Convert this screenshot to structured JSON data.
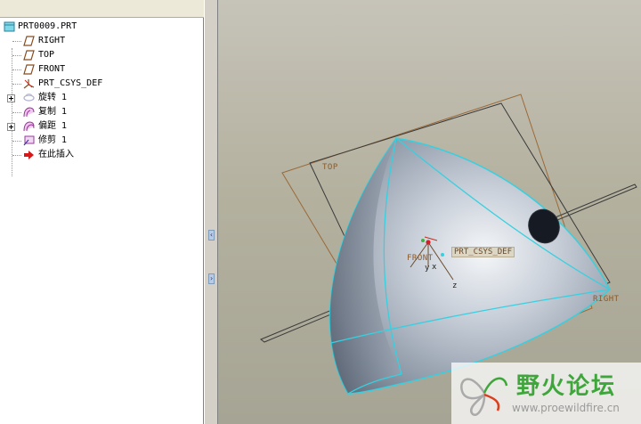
{
  "model_tree": {
    "root": "PRT0009.PRT",
    "items": [
      {
        "label": "RIGHT",
        "icon": "datum-plane-icon"
      },
      {
        "label": "TOP",
        "icon": "datum-plane-icon"
      },
      {
        "label": "FRONT",
        "icon": "datum-plane-icon"
      },
      {
        "label": "PRT_CSYS_DEF",
        "icon": "coordinate-system-icon"
      },
      {
        "label": "旋转 1",
        "icon": "revolve-icon"
      },
      {
        "label": "复制 1",
        "icon": "copy-surface-icon"
      },
      {
        "label": "偏距 1",
        "icon": "offset-icon"
      },
      {
        "label": "修剪 1",
        "icon": "trim-icon"
      },
      {
        "label": "在此插入",
        "icon": "insert-here-arrow-icon"
      }
    ]
  },
  "viewport": {
    "datum_labels": {
      "top": "TOP",
      "right": "RIGHT",
      "front": "FRONT"
    },
    "csys_label": "PRT_CSYS_DEF",
    "axis_labels": {
      "y": "y",
      "x": "x",
      "z": "z"
    },
    "colors": {
      "datum_plane": "#9a6a3a",
      "surface_edge": "#36d0e0",
      "surface_fill": "#aeb8c4",
      "csys_origin": "#d0202a"
    }
  },
  "watermark": {
    "title": "野火论坛",
    "url": "www.proewildfire.cn"
  }
}
